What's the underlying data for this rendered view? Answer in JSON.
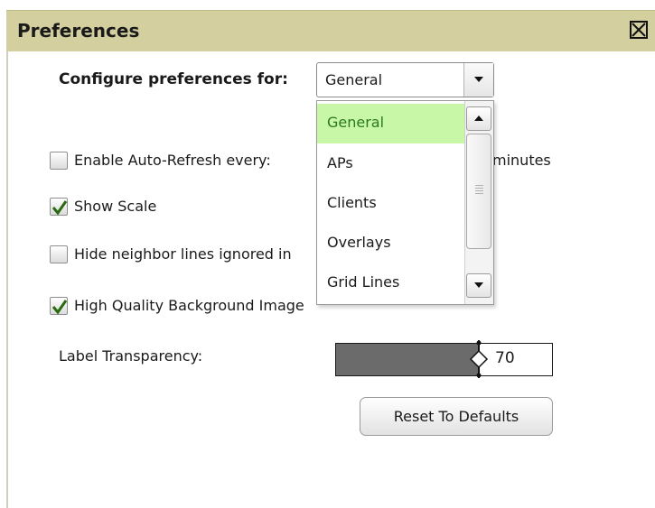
{
  "window": {
    "title": "Preferences",
    "close_icon": "close-box-icon"
  },
  "configure": {
    "label": "Configure preferences for:",
    "selected": "General",
    "options": [
      "General",
      "APs",
      "Clients",
      "Overlays",
      "Grid Lines"
    ]
  },
  "settings": {
    "auto_refresh": {
      "label": "Enable Auto-Refresh every:",
      "checked": false,
      "suffix": "minutes"
    },
    "show_scale": {
      "label": "Show Scale",
      "checked": true
    },
    "hide_neighbor": {
      "label": "Hide neighbor lines ignored in",
      "checked": false
    },
    "high_quality": {
      "label": "High Quality Background Image",
      "checked": true
    }
  },
  "label_transparency": {
    "label": "Label Transparency:",
    "value": "70",
    "fraction": 0.66
  },
  "reset_button": "Reset To Defaults",
  "colors": {
    "title_bar": "#d3cf9f",
    "selected_option_bg": "#c9f7a8",
    "selected_option_text": "#2a7a1a",
    "slider_fill": "#6b6b6b"
  }
}
